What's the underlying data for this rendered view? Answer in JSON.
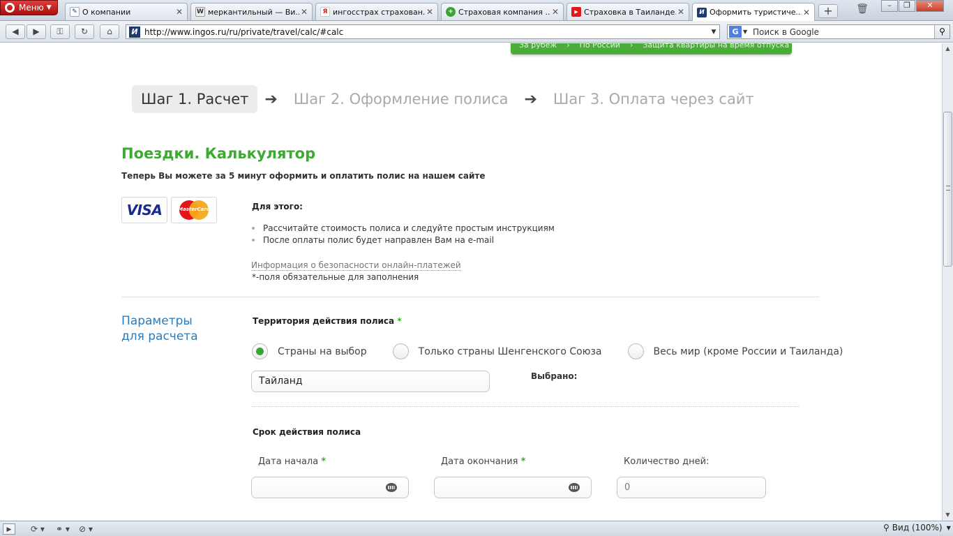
{
  "browser": {
    "menu_label": "Меню",
    "tabs": [
      {
        "title": "О компании",
        "favicon_text": "",
        "favicon_color": "#ffffff"
      },
      {
        "title": "меркантильный — Ви...",
        "favicon_text": "W",
        "favicon_color": "#666666"
      },
      {
        "title": "ингосстрах страхован...",
        "favicon_text": "Я",
        "favicon_color": "#ffffff"
      },
      {
        "title": "Страховая компания ...",
        "favicon_text": "+",
        "favicon_color": "#3aa535"
      },
      {
        "title": "Страховка в Таиланде...",
        "favicon_text": "▶",
        "favicon_color": "#e01a1a"
      },
      {
        "title": "Оформить туристиче...",
        "favicon_text": "И",
        "favicon_color": "#1f3a73"
      }
    ],
    "url": "http://www.ingos.ru/ru/private/travel/calc/#calc",
    "site_icon_text": "И",
    "search_placeholder": "Поиск в Google",
    "search_engine_icon": "G",
    "zoom_label": "Вид (100%)"
  },
  "top_menu": {
    "items": [
      "За рубеж",
      "По России",
      "Защита квартиры на время отпуска"
    ]
  },
  "steps": {
    "step1": "Шаг 1. Расчет",
    "step2": "Шаг 2. Оформление полиса",
    "step3": "Шаг 3. Оплата через сайт",
    "arrow": "➔"
  },
  "page": {
    "title": "Поездки. Калькулятор",
    "subtitle": "Теперь Вы можете за 5 минут оформить и оплатить полис на нашем сайте",
    "visa_text": "VISA",
    "mastercard_text": "MasterCard",
    "for_this": "Для этого:",
    "instructions": [
      "Рассчитайте стоимость полиса и следуйте простым инструкциям",
      "После оплаты полис будет направлен Вам на e-mail"
    ],
    "security_link": "Информация о безопасности онлайн-платежей",
    "required_note": "*-поля обязательные для заполнения"
  },
  "params": {
    "title_line1": "Параметры",
    "title_line2": "для расчета",
    "territory_label": "Территория действия полиса",
    "required_mark": "*",
    "territory_options": [
      {
        "label": "Страны на выбор",
        "checked": true
      },
      {
        "label": "Только страны Шенгенского Союза",
        "checked": false
      },
      {
        "label": "Весь мир (кроме России и Таиланда)",
        "checked": false
      }
    ],
    "country_value": "Тайланд",
    "selected_label": "Выбрано:",
    "term_label": "Срок действия полиса",
    "start_date_label": "Дата начала",
    "end_date_label": "Дата окончания",
    "days_label": "Количество дней:",
    "days_value": "0"
  },
  "colors": {
    "brand_green": "#3daa32",
    "link_blue": "#2b7bb9"
  }
}
